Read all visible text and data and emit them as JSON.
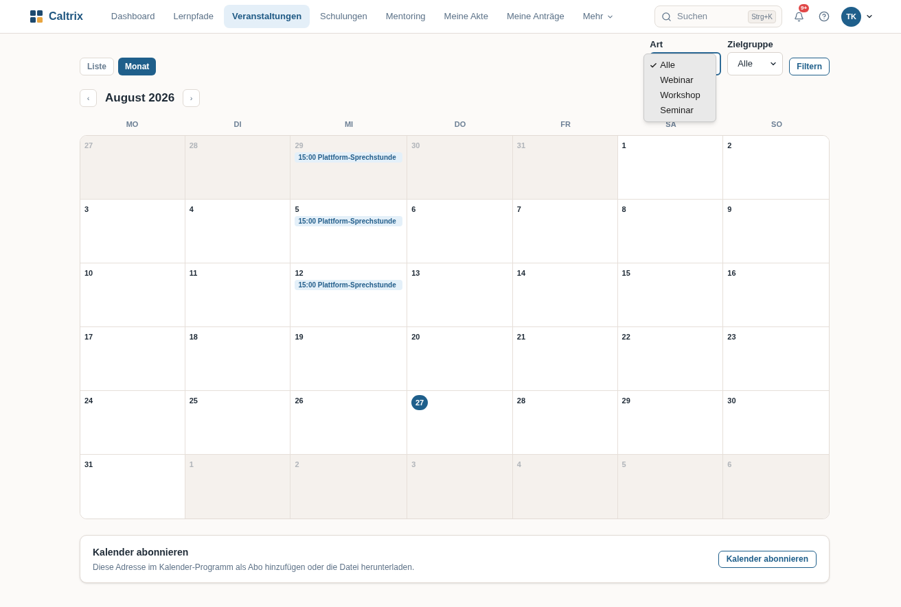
{
  "header": {
    "brand": "Caltrix",
    "nav": [
      {
        "label": "Dashboard",
        "selected": false,
        "kind": "link"
      },
      {
        "label": "Lernpfade",
        "selected": false,
        "kind": "link"
      },
      {
        "label": "Veranstaltungen",
        "selected": true,
        "kind": "link"
      },
      {
        "label": "Schulungen",
        "selected": false,
        "kind": "link"
      },
      {
        "label": "Mentoring",
        "selected": false,
        "kind": "link"
      },
      {
        "label": "Meine Akte",
        "selected": false,
        "kind": "link"
      },
      {
        "label": "Meine Anträge",
        "selected": false,
        "kind": "link"
      },
      {
        "label": "Mehr",
        "selected": false,
        "kind": "menu"
      }
    ],
    "search": {
      "placeholder": "Suchen",
      "shortcut": "Strg+K"
    },
    "notifications": {
      "badge": "9+"
    },
    "user": {
      "initials": "TK"
    }
  },
  "view_toggle": [
    {
      "label": "Liste",
      "selected": false
    },
    {
      "label": "Monat",
      "selected": true
    }
  ],
  "filters": {
    "art": {
      "label": "Art",
      "expanded": true,
      "options": [
        {
          "label": "Alle",
          "selected": true
        },
        {
          "label": "Webinar",
          "selected": false
        },
        {
          "label": "Workshop",
          "selected": false
        },
        {
          "label": "Seminar",
          "selected": false
        }
      ]
    },
    "zielgruppe": {
      "label": "Zielgruppe",
      "value": "Alle"
    },
    "button": "Filtern"
  },
  "calendar": {
    "prev": "‹",
    "title": "August 2026",
    "next": "›",
    "weekdays": [
      "MO",
      "DI",
      "MI",
      "DO",
      "FR",
      "SA",
      "SO"
    ],
    "weeks": [
      [
        {
          "day": "27",
          "in_month": false,
          "today": false
        },
        {
          "day": "28",
          "in_month": false,
          "today": false
        },
        {
          "day": "29",
          "in_month": false,
          "today": false,
          "events": [
            "15:00 Plattform-Sprechstunde"
          ]
        },
        {
          "day": "30",
          "in_month": false,
          "today": false
        },
        {
          "day": "31",
          "in_month": false,
          "today": false
        },
        {
          "day": "1",
          "in_month": true,
          "today": false
        },
        {
          "day": "2",
          "in_month": true,
          "today": false
        }
      ],
      [
        {
          "day": "3",
          "in_month": true,
          "today": false
        },
        {
          "day": "4",
          "in_month": true,
          "today": false
        },
        {
          "day": "5",
          "in_month": true,
          "today": false,
          "events": [
            "15:00 Plattform-Sprechstunde"
          ]
        },
        {
          "day": "6",
          "in_month": true,
          "today": false
        },
        {
          "day": "7",
          "in_month": true,
          "today": false
        },
        {
          "day": "8",
          "in_month": true,
          "today": false
        },
        {
          "day": "9",
          "in_month": true,
          "today": false
        }
      ],
      [
        {
          "day": "10",
          "in_month": true,
          "today": false
        },
        {
          "day": "11",
          "in_month": true,
          "today": false
        },
        {
          "day": "12",
          "in_month": true,
          "today": false,
          "events": [
            "15:00 Plattform-Sprechstunde"
          ]
        },
        {
          "day": "13",
          "in_month": true,
          "today": false
        },
        {
          "day": "14",
          "in_month": true,
          "today": false
        },
        {
          "day": "15",
          "in_month": true,
          "today": false
        },
        {
          "day": "16",
          "in_month": true,
          "today": false
        }
      ],
      [
        {
          "day": "17",
          "in_month": true,
          "today": false
        },
        {
          "day": "18",
          "in_month": true,
          "today": false
        },
        {
          "day": "19",
          "in_month": true,
          "today": false
        },
        {
          "day": "20",
          "in_month": true,
          "today": false
        },
        {
          "day": "21",
          "in_month": true,
          "today": false
        },
        {
          "day": "22",
          "in_month": true,
          "today": false
        },
        {
          "day": "23",
          "in_month": true,
          "today": false
        }
      ],
      [
        {
          "day": "24",
          "in_month": true,
          "today": false
        },
        {
          "day": "25",
          "in_month": true,
          "today": false
        },
        {
          "day": "26",
          "in_month": true,
          "today": false
        },
        {
          "day": "27",
          "in_month": true,
          "today": true
        },
        {
          "day": "28",
          "in_month": true,
          "today": false
        },
        {
          "day": "29",
          "in_month": true,
          "today": false
        },
        {
          "day": "30",
          "in_month": true,
          "today": false
        }
      ],
      [
        {
          "day": "31",
          "in_month": true,
          "today": false
        },
        {
          "day": "1",
          "in_month": false,
          "today": false
        },
        {
          "day": "2",
          "in_month": false,
          "today": false
        },
        {
          "day": "3",
          "in_month": false,
          "today": false
        },
        {
          "day": "4",
          "in_month": false,
          "today": false
        },
        {
          "day": "5",
          "in_month": false,
          "today": false
        },
        {
          "day": "6",
          "in_month": false,
          "today": false
        }
      ]
    ]
  },
  "subscribe": {
    "title": "Kalender abonnieren",
    "description": "Diese Adresse im Kalender-Programm als Abo hinzufügen oder die Datei herunterladen.",
    "button": "Kalender abonnieren"
  }
}
